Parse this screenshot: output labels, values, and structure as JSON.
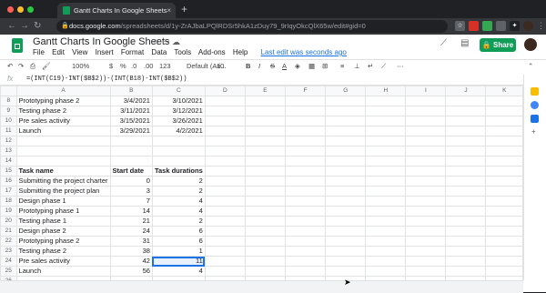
{
  "browser": {
    "tab_title": "Gantt Charts In Google Sheets",
    "tab_close": "×",
    "new_tab": "+",
    "url_host": "docs.google.com",
    "url_path": "/spreadsheets/d/1y-ZrAJbaLPQlRDSr5hkA1zDuy79_9rIqyOkcQlX65w/edit#gid=0",
    "lock": "🔒"
  },
  "app": {
    "title": "Gantt Charts In Google Sheets",
    "menu": [
      "File",
      "Edit",
      "View",
      "Insert",
      "Format",
      "Data",
      "Tools",
      "Add-ons",
      "Help"
    ],
    "last_edit": "Last edit was seconds ago",
    "share_label": "Share",
    "accent": "#0f9d58"
  },
  "toolbar": {
    "zoom": "100%",
    "currency": "$",
    "percent": "%",
    "dec_less": ".0",
    "dec_more": ".00",
    "format_more": "123",
    "font": "Default (Ari...",
    "font_size": "10",
    "bold": "B",
    "italic": "I",
    "strike": "S",
    "text_color": "A"
  },
  "formula_bar": {
    "fx": "fx",
    "formula": "=(INT(C19)-INT($B$2))-(INT(B18)-INT($B$2))"
  },
  "columns": [
    "A",
    "B",
    "C",
    "D",
    "E",
    "F",
    "G",
    "H",
    "I",
    "J",
    "K"
  ],
  "rows": [
    {
      "n": "8",
      "a": "Prototyping phase 2",
      "b": "3/4/2021",
      "c": "3/10/2021"
    },
    {
      "n": "9",
      "a": "Testing phase 2",
      "b": "3/11/2021",
      "c": "3/12/2021"
    },
    {
      "n": "10",
      "a": "Pre sales activity",
      "b": "3/15/2021",
      "c": "3/26/2021"
    },
    {
      "n": "11",
      "a": "Launch",
      "b": "3/29/2021",
      "c": "4/2/2021"
    },
    {
      "n": "12",
      "a": "",
      "b": "",
      "c": ""
    },
    {
      "n": "13",
      "a": "",
      "b": "",
      "c": ""
    },
    {
      "n": "14",
      "a": "",
      "b": "",
      "c": ""
    },
    {
      "n": "15",
      "a": "Task name",
      "b": "Start date",
      "c": "Task durations",
      "header": true
    },
    {
      "n": "16",
      "a": "Submitting the project charter",
      "b": "0",
      "c": "2"
    },
    {
      "n": "17",
      "a": "Submitting the project plan",
      "b": "3",
      "c": "2"
    },
    {
      "n": "18",
      "a": "Design phase 1",
      "b": "7",
      "c": "4"
    },
    {
      "n": "19",
      "a": "Prototyping phase 1",
      "b": "14",
      "c": "4"
    },
    {
      "n": "20",
      "a": "Testing phase 1",
      "b": "21",
      "c": "2"
    },
    {
      "n": "21",
      "a": "Design phase 2",
      "b": "24",
      "c": "6"
    },
    {
      "n": "22",
      "a": "Prototyping phase 2",
      "b": "31",
      "c": "6"
    },
    {
      "n": "23",
      "a": "Testing phase 2",
      "b": "38",
      "c": "1"
    },
    {
      "n": "24",
      "a": "Pre sales activity",
      "b": "42",
      "c": "11",
      "selected": true
    },
    {
      "n": "25",
      "a": "Launch",
      "b": "56",
      "c": "4"
    },
    {
      "n": "26",
      "a": "",
      "b": "",
      "c": ""
    }
  ]
}
